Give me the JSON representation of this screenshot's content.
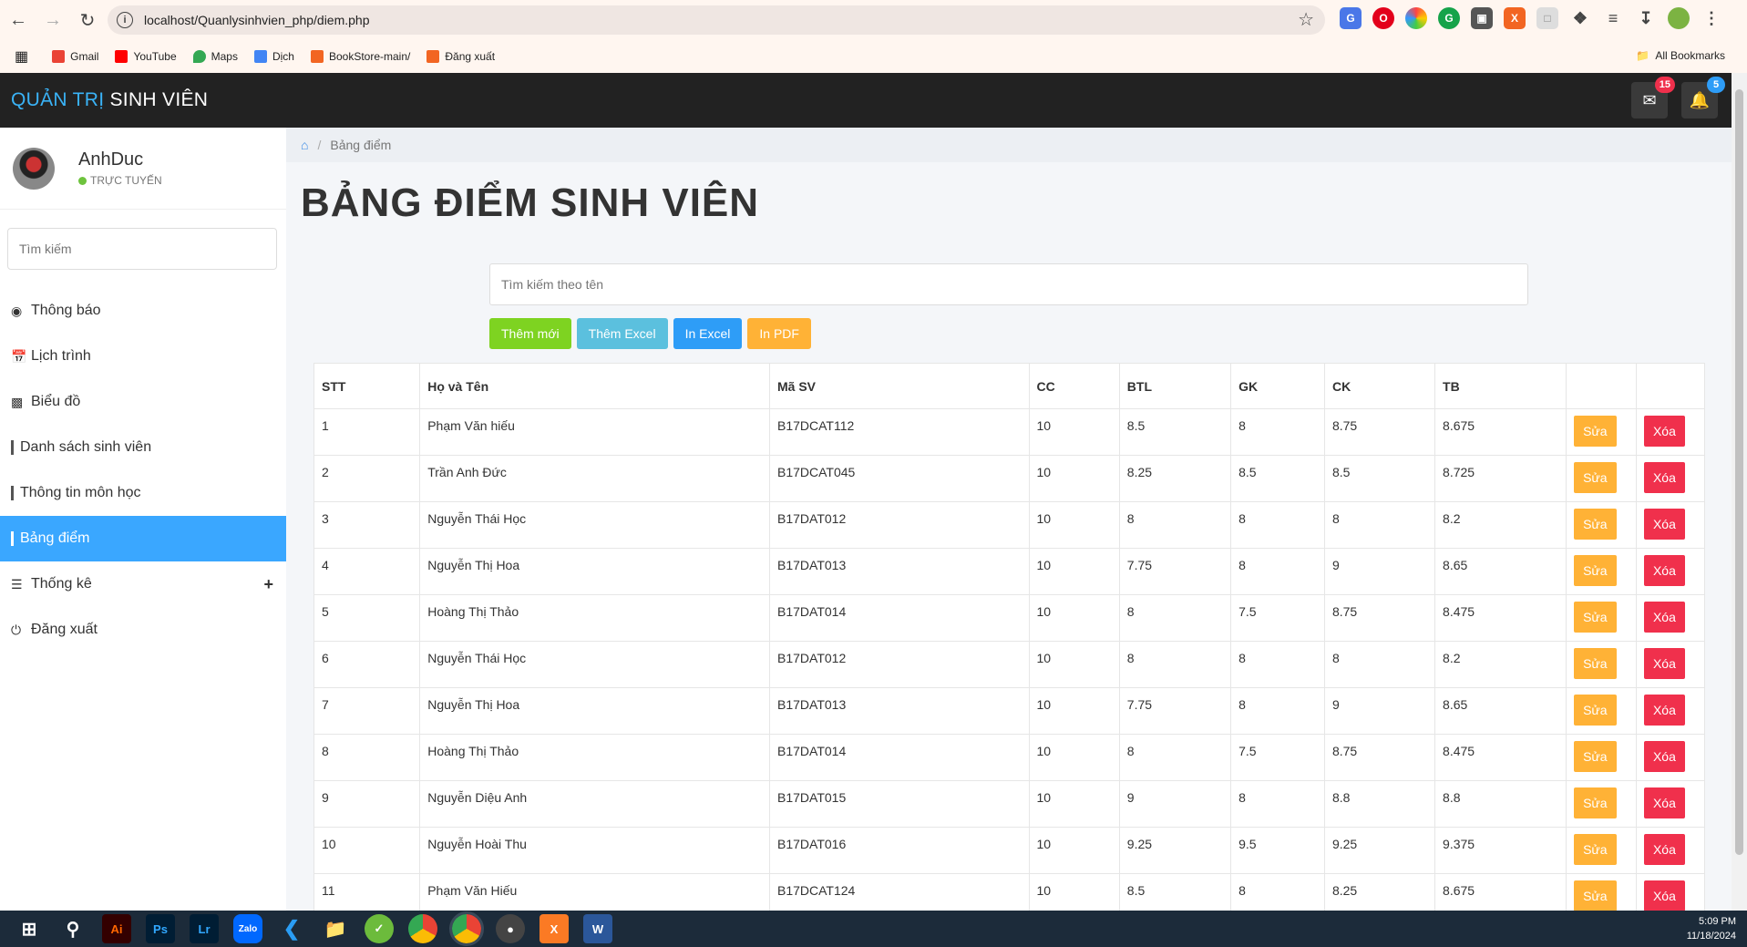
{
  "browser": {
    "url": "localhost/Quanlysinhvien_php/diem.php",
    "bookmarks": [
      {
        "label": "Gmail",
        "color": "#ea4335"
      },
      {
        "label": "YouTube",
        "color": "#ff0000"
      },
      {
        "label": "Maps",
        "color": "#34a853"
      },
      {
        "label": "Dịch",
        "color": "#4285f4"
      },
      {
        "label": "BookStore-main/",
        "color": "#f26522"
      },
      {
        "label": "Đăng xuất",
        "color": "#f26522"
      }
    ],
    "all_bookmarks": "All Bookmarks"
  },
  "header": {
    "brand_part1": "QUẢN TRỊ",
    "brand_part2": "SINH VIÊN",
    "mail_badge": "15",
    "bell_badge": "5"
  },
  "sidebar": {
    "username": "AnhDuc",
    "status": "TRỰC TUYẾN",
    "search_placeholder": "Tìm kiếm",
    "items": [
      {
        "label": "Thông báo",
        "icon": "dashboard-icon"
      },
      {
        "label": "Lịch trình",
        "icon": "calendar-icon"
      },
      {
        "label": "Biểu đồ",
        "icon": "chart-icon"
      },
      {
        "label": "Danh sách sinh viên",
        "icon": "bar"
      },
      {
        "label": "Thông tin môn học",
        "icon": "bar"
      },
      {
        "label": "Bảng điểm",
        "icon": "bar"
      },
      {
        "label": "Thống kê",
        "icon": "list-icon"
      },
      {
        "label": "Đăng xuất",
        "icon": "power-icon"
      }
    ]
  },
  "main": {
    "breadcrumb_current": "Bảng điểm",
    "title": "BẢNG ĐIỂM SINH VIÊN",
    "search_placeholder": "Tìm kiếm theo tên",
    "buttons": {
      "add_new": "Thêm mới",
      "add_excel": "Thêm Excel",
      "export_excel": "In Excel",
      "export_pdf": "In PDF"
    },
    "columns": [
      "STT",
      "Họ và Tên",
      "Mã SV",
      "CC",
      "BTL",
      "GK",
      "CK",
      "TB",
      "",
      ""
    ],
    "edit_label": "Sửa",
    "delete_label": "Xóa",
    "rows": [
      [
        "1",
        "Phạm Văn hiếu",
        "B17DCAT112",
        "10",
        "8.5",
        "8",
        "8.75",
        "8.675"
      ],
      [
        "2",
        "Trần Anh Đức",
        "B17DCAT045",
        "10",
        "8.25",
        "8.5",
        "8.5",
        "8.725"
      ],
      [
        "3",
        "Nguyễn Thái Học",
        "B17DAT012",
        "10",
        "8",
        "8",
        "8",
        "8.2"
      ],
      [
        "4",
        "Nguyễn Thị Hoa",
        "B17DAT013",
        "10",
        "7.75",
        "8",
        "9",
        "8.65"
      ],
      [
        "5",
        "Hoàng Thị Thảo",
        "B17DAT014",
        "10",
        "8",
        "7.5",
        "8.75",
        "8.475"
      ],
      [
        "6",
        "Nguyễn Thái Học",
        "B17DAT012",
        "10",
        "8",
        "8",
        "8",
        "8.2"
      ],
      [
        "7",
        "Nguyễn Thị Hoa",
        "B17DAT013",
        "10",
        "7.75",
        "8",
        "9",
        "8.65"
      ],
      [
        "8",
        "Hoàng Thị Thảo",
        "B17DAT014",
        "10",
        "8",
        "7.5",
        "8.75",
        "8.475"
      ],
      [
        "9",
        "Nguyễn Diệu Anh",
        "B17DAT015",
        "10",
        "9",
        "8",
        "8.8",
        "8.8"
      ],
      [
        "10",
        "Nguyễn Hoài Thu",
        "B17DAT016",
        "10",
        "9.25",
        "9.5",
        "9.25",
        "9.375"
      ],
      [
        "11",
        "Phạm Văn Hiếu",
        "B17DCAT124",
        "10",
        "8.5",
        "8",
        "8.25",
        "8.675"
      ]
    ]
  },
  "colors": {
    "accent": "#3aa7ff",
    "green": "#7ed321",
    "teal": "#5bc0de",
    "blue": "#2e9df7",
    "orange": "#ffb236",
    "red": "#f0304c"
  },
  "taskbar": {
    "time": "5:09 PM",
    "date": "11/18/2024"
  }
}
